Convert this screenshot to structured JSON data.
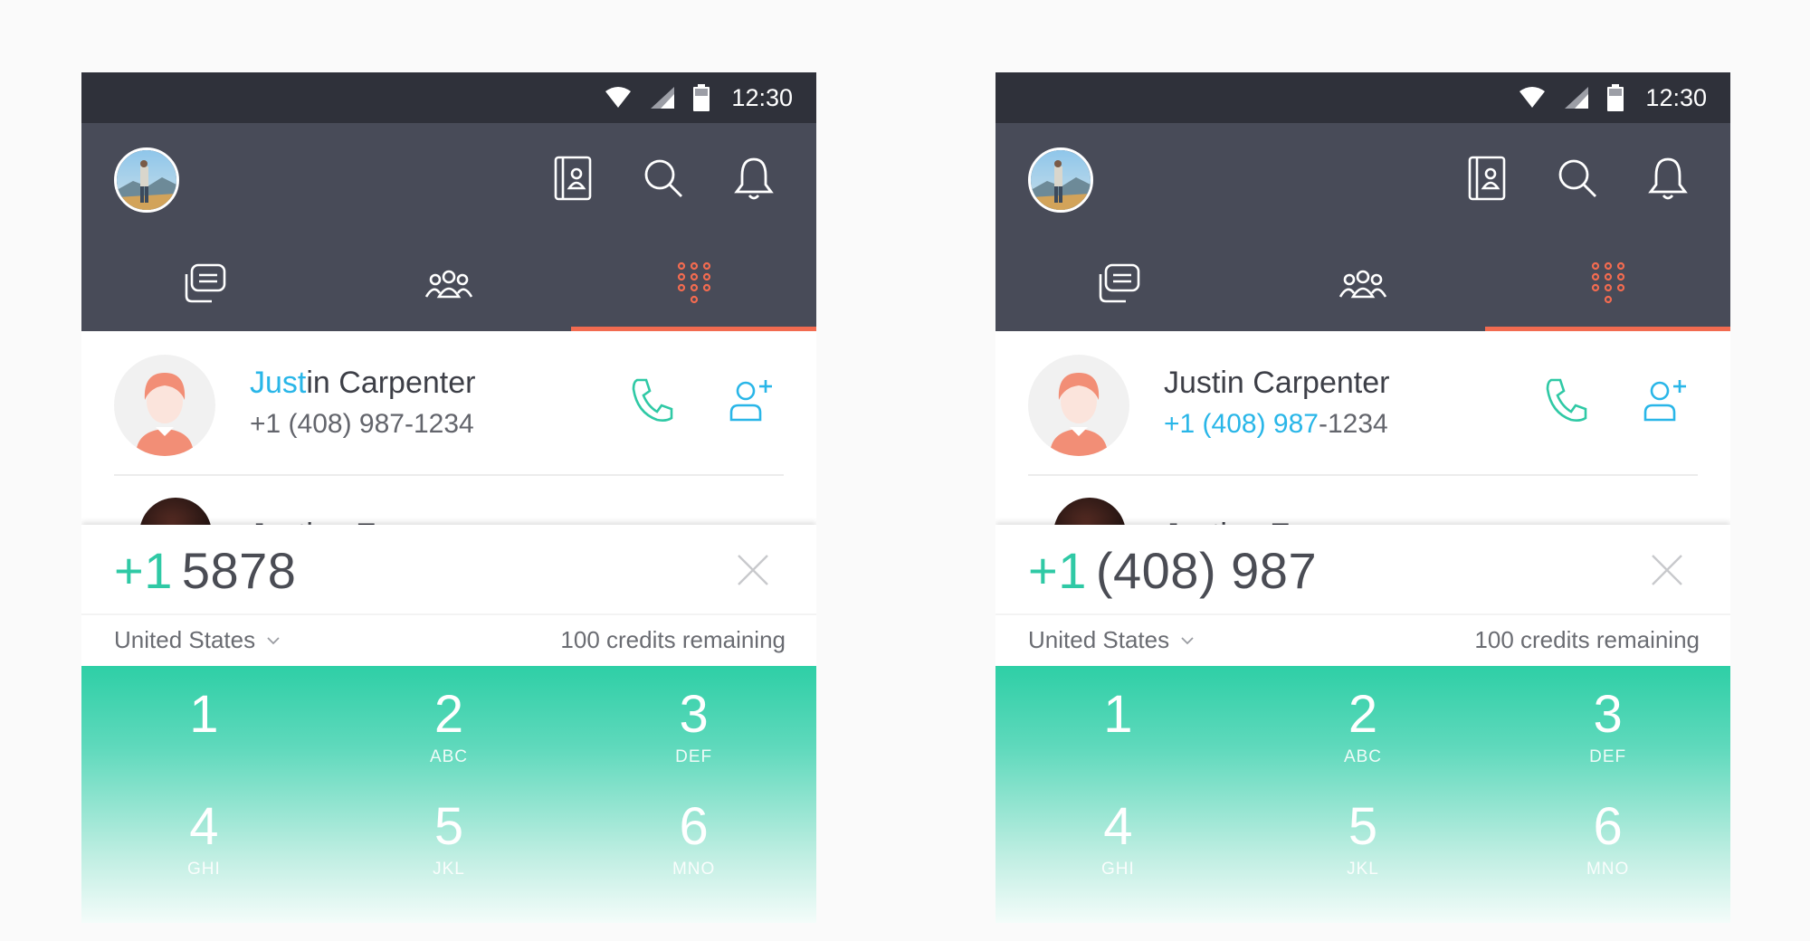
{
  "colors": {
    "accent_green": "#2fc9a5",
    "accent_blue": "#29b6e8",
    "tab_indicator": "#f26b50",
    "appbar": "#484b58",
    "statusbar": "#2f313a"
  },
  "screens": [
    {
      "status": {
        "time": "12:30",
        "icons": [
          "wifi-icon",
          "signal-icon",
          "battery-icon"
        ]
      },
      "appbar": {
        "icons": [
          "contacts-book-icon",
          "search-icon",
          "bell-icon"
        ]
      },
      "tabs": [
        {
          "icon": "chat-icon",
          "active": false
        },
        {
          "icon": "group-icon",
          "active": false
        },
        {
          "icon": "dialpad-icon",
          "active": true
        }
      ],
      "contacts": [
        {
          "name_hl": "Just",
          "name_rest": "in Carpenter",
          "phone_hl": "",
          "phone_rest": "+1 (408) 987-1234"
        },
        {
          "name_partial": "Justine Ezra"
        }
      ],
      "dialer": {
        "country_code": "+1",
        "number": "5878",
        "country": "United States",
        "credits": "100 credits remaining"
      },
      "keys": [
        {
          "digit": "1",
          "letters": ""
        },
        {
          "digit": "2",
          "letters": "ABC"
        },
        {
          "digit": "3",
          "letters": "DEF"
        },
        {
          "digit": "4",
          "letters": "GHI"
        },
        {
          "digit": "5",
          "letters": "JKL"
        },
        {
          "digit": "6",
          "letters": "MNO"
        }
      ]
    },
    {
      "status": {
        "time": "12:30",
        "icons": [
          "wifi-icon",
          "signal-icon",
          "battery-icon"
        ]
      },
      "appbar": {
        "icons": [
          "contacts-book-icon",
          "search-icon",
          "bell-icon"
        ]
      },
      "tabs": [
        {
          "icon": "chat-icon",
          "active": false
        },
        {
          "icon": "group-icon",
          "active": false
        },
        {
          "icon": "dialpad-icon",
          "active": true
        }
      ],
      "contacts": [
        {
          "name_hl": "",
          "name_rest": "Justin Carpenter",
          "phone_hl": "+1 (408) 987",
          "phone_rest": "-1234"
        },
        {
          "name_partial": "Justine Ezra"
        }
      ],
      "dialer": {
        "country_code": "+1",
        "number": "(408) 987",
        "country": "United States",
        "credits": "100 credits remaining"
      },
      "keys": [
        {
          "digit": "1",
          "letters": ""
        },
        {
          "digit": "2",
          "letters": "ABC"
        },
        {
          "digit": "3",
          "letters": "DEF"
        },
        {
          "digit": "4",
          "letters": "GHI"
        },
        {
          "digit": "5",
          "letters": "JKL"
        },
        {
          "digit": "6",
          "letters": "MNO"
        }
      ]
    }
  ]
}
